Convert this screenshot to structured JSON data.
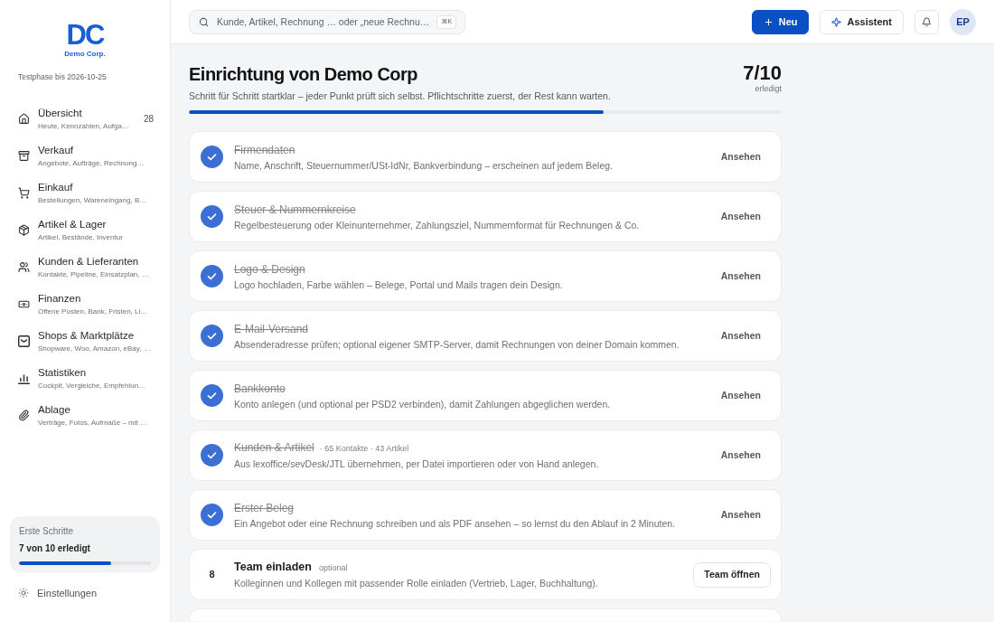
{
  "sidebar": {
    "logo": {
      "mark": "DC",
      "name": "Demo Corp."
    },
    "trial": "Testphase bis 2026-10-25",
    "nav": [
      {
        "title": "Übersicht",
        "subtitle": "Heute, Kennzahlen, Aufga…",
        "badge": "28",
        "selected": false
      },
      {
        "title": "Verkauf",
        "subtitle": "Angebote, Aufträge, Rechnung…",
        "selected": false
      },
      {
        "title": "Einkauf",
        "subtitle": "Bestellungen, Wareneingang, B…",
        "selected": false
      },
      {
        "title": "Artikel & Lager",
        "subtitle": "Artikel, Bestände, Inventur",
        "selected": false
      },
      {
        "title": "Kunden & Lieferanten",
        "subtitle": "Kontakte, Pipeline, Einsatzplan, …",
        "selected": false
      },
      {
        "title": "Finanzen",
        "subtitle": "Offene Posten, Bank, Fristen, Li…",
        "selected": false
      },
      {
        "title": "Shops & Marktplätze",
        "subtitle": "Shopware, Woo, Amazon, eBay, …",
        "selected": false
      },
      {
        "title": "Statistiken",
        "subtitle": "Cockpit, Vergleiche, Empfehlun…",
        "selected": false
      },
      {
        "title": "Ablage",
        "subtitle": "Verträge, Fotos, Aufmaße – mit …",
        "selected": false
      }
    ],
    "onboarding": {
      "label": "Erste Schritte",
      "status": "7 von 10 erledigt",
      "level": 0.7
    },
    "settings": "Einstellungen"
  },
  "header": {
    "search": {
      "placeholder": "Kunde, Artikel, Rechnung … oder „neue Rechnu…",
      "shortcut": "⌘K"
    },
    "buttons": [
      {
        "label": "Neu",
        "kind": "primary"
      },
      {
        "label": "Assistent",
        "kind": "secondary"
      }
    ],
    "avatar": "EP"
  },
  "setup": {
    "title": "Einrichtung von Demo Corp",
    "subtitle": "Schritt für Schritt startklar – jeder Punkt prüft sich selbst. Pflichtschritte zuerst, der Rest kann warten.",
    "count": "7/10",
    "count_label": "erledigt",
    "progress": {
      "level": 0.7
    },
    "steps": [
      {
        "done": true,
        "title": "Firmendaten",
        "description": "Name, Anschrift, Steuernummer/USt-IdNr, Bankverbindung – erscheinen auf jedem Beleg.",
        "action": "Ansehen"
      },
      {
        "done": true,
        "title": "Steuer & Nummernkreise",
        "description": "Regelbesteuerung oder Kleinunternehmer, Zahlungsziel, Nummernformat für Rechnungen & Co.",
        "action": "Ansehen"
      },
      {
        "done": true,
        "title": "Logo & Design",
        "description": "Logo hochladen, Farbe wählen – Belege, Portal und Mails tragen dein Design.",
        "action": "Ansehen"
      },
      {
        "done": true,
        "title": "E-Mail-Versand",
        "description": "Absenderadresse prüfen; optional eigener SMTP-Server, damit Rechnungen von deiner Domain kommen.",
        "action": "Ansehen"
      },
      {
        "done": true,
        "title": "Bankkonto",
        "description": "Konto anlegen (und optional per PSD2 verbinden), damit Zahlungen abgeglichen werden.",
        "action": "Ansehen"
      },
      {
        "done": true,
        "title": "Kunden & Artikel",
        "meta": "· 65 Kontakte · 43 Artikel",
        "description": "Aus lexoffice/sevDesk/JTL übernehmen, per Datei importieren oder von Hand anlegen.",
        "action": "Ansehen"
      },
      {
        "done": true,
        "title": "Erster Beleg",
        "description": "Ein Angebot oder eine Rechnung schreiben und als PDF ansehen – so lernst du den Ablauf in 2 Minuten.",
        "action": "Ansehen"
      },
      {
        "done": false,
        "number": "8",
        "title": "Team einladen",
        "tag": "optional",
        "description": "Kolleginnen und Kollegen mit passender Rolle einladen (Vertrieb, Lager, Buchhaltung).",
        "action": "Team öffnen"
      }
    ],
    "more_below": true
  }
}
